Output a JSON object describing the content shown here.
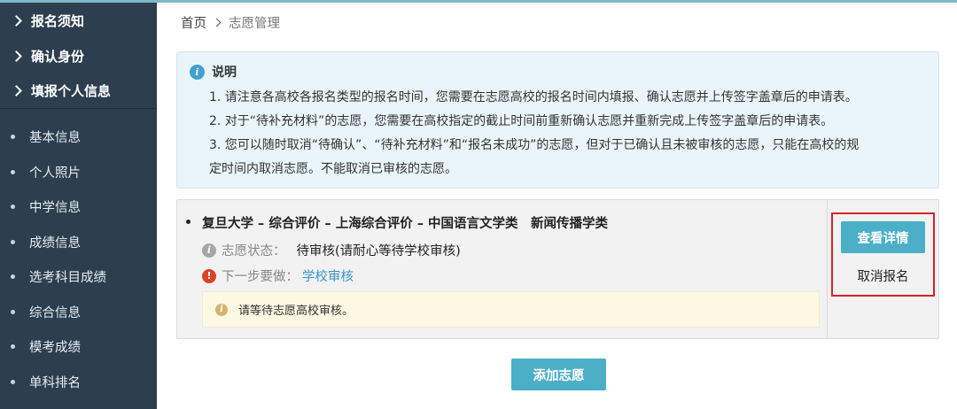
{
  "sidebar": {
    "sections": [
      {
        "label": "报名须知"
      },
      {
        "label": "确认身份"
      },
      {
        "label": "填报个人信息"
      }
    ],
    "items": [
      {
        "label": "基本信息"
      },
      {
        "label": "个人照片"
      },
      {
        "label": "中学信息"
      },
      {
        "label": "成绩信息"
      },
      {
        "label": "选考科目成绩"
      },
      {
        "label": "综合信息"
      },
      {
        "label": "模考成绩"
      },
      {
        "label": "单科排名"
      }
    ]
  },
  "breadcrumb": {
    "home": "首页",
    "current": "志愿管理"
  },
  "notice": {
    "title": "说明",
    "lines": [
      "1. 请注意各高校各报名类型的报名时间，您需要在志愿高校的报名时间内填报、确认志愿并上传签字盖章后的申请表。",
      "2. 对于“待补充材料”的志愿，您需要在高校指定的截止时间前重新确认志愿并重新完成上传签字盖章后的申请表。",
      "3. 您可以随时取消“待确认”、“待补充材料”和“报名未成功”的志愿，但对于已确认且未被审核的志愿，只能在高校的规",
      "定时间内取消志愿。不能取消已审核的志愿。"
    ]
  },
  "application": {
    "title": "复旦大学 – 综合评价 – 上海综合评价 – 中国语言文学类　新闻传播学类",
    "status_label": "志愿状态：",
    "status_value": "待审核(请耐心等待学校审核)",
    "next_label": "下一步要做：",
    "next_link": "学校审核",
    "wait_message": "请等待志愿高校审核。",
    "detail_button": "查看详情",
    "cancel_button": "取消报名"
  },
  "add_button": "添加志愿",
  "colors": {
    "sidebar_bg": "#2d3e4e",
    "accent": "#4bafc7",
    "link": "#3a94c8",
    "highlight_box": "#d4222a"
  }
}
